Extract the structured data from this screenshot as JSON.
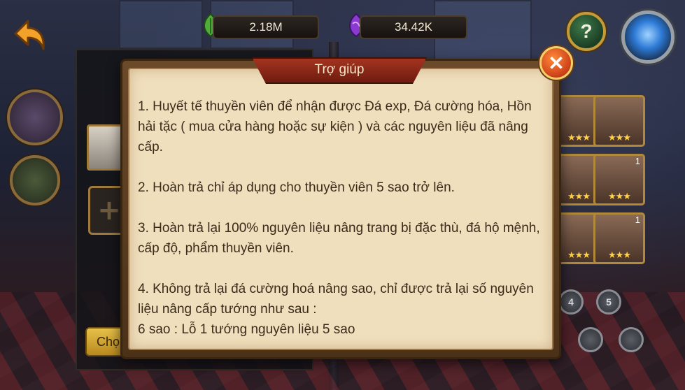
{
  "resources": {
    "gold": "2.18M",
    "gems": "34.42K"
  },
  "dialog": {
    "title": "Trợ giúp",
    "close_label": "✕",
    "paragraphs": [
      "1. Huyết tế thuyền viên để nhận được Đá exp, Đá cường hóa, Hồn hải tặc ( mua cửa hàng hoặc sự kiện ) và các nguyên liệu đã nâng cấp.",
      "2. Hoàn trả chỉ áp dụng cho thuyền viên 5 sao trở lên.",
      "3. Hoàn trả lại 100% nguyên liệu nâng trang bị đặc thù, đá hộ mệnh, cấp độ, phẩm thuyền viên.",
      "4. Không trả lại đá cường hoá nâng sao, chỉ được trả lại số nguyên liệu nâng cấp tướng như sau :",
      "6 sao : Lỗ 1 tướng nguyên liệu 5 sao"
    ]
  },
  "help_button_label": "?",
  "left_panel": {
    "choose_label": "Chọ",
    "plus_label": "+"
  },
  "hero_grid": {
    "cards": [
      {
        "level": "1",
        "stars": "★★★"
      },
      {
        "level": "1",
        "stars": "★★★"
      },
      {
        "level": "1",
        "stars": "★★★"
      },
      {
        "level": "1",
        "stars": "★★★"
      }
    ],
    "star_filters": [
      "4",
      "5"
    ]
  },
  "icons": {
    "back": "back-arrow-icon",
    "gold": "green-leaf-currency-icon",
    "gems": "purple-gem-currency-icon",
    "help": "question-icon",
    "close": "close-icon"
  },
  "colors": {
    "dialog_paper": "#f0dfbd",
    "title_ribbon": "#a3341f",
    "text": "#3a2b1a",
    "close_button": "#d0441a"
  }
}
